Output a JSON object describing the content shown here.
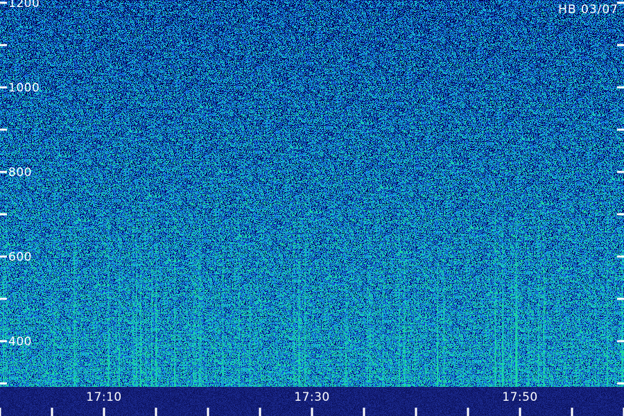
{
  "title": "HB 03/07",
  "colors": {
    "background": "#0a1a6e",
    "noise_low": "#000000",
    "noise_mid": "#1840c8",
    "noise_high": "#2aa0e0",
    "peak": "#20e0a0",
    "label": "#ffffff"
  },
  "chart_data": {
    "type": "heatmap",
    "title": "HB 03/07",
    "xlabel": "",
    "ylabel": "",
    "ylim": [
      0,
      1200
    ],
    "y_ticks": [
      {
        "value": 1200,
        "label": "1200"
      },
      {
        "value": 1000,
        "label": "1000"
      },
      {
        "value": 800,
        "label": "800"
      },
      {
        "value": 600,
        "label": "600"
      },
      {
        "value": 400,
        "label": "400"
      }
    ],
    "x_ticks": [
      {
        "value": "17:10",
        "label": "17:10"
      },
      {
        "value": "17:30",
        "label": "17:30"
      },
      {
        "value": "17:50",
        "label": "17:50"
      }
    ]
  }
}
